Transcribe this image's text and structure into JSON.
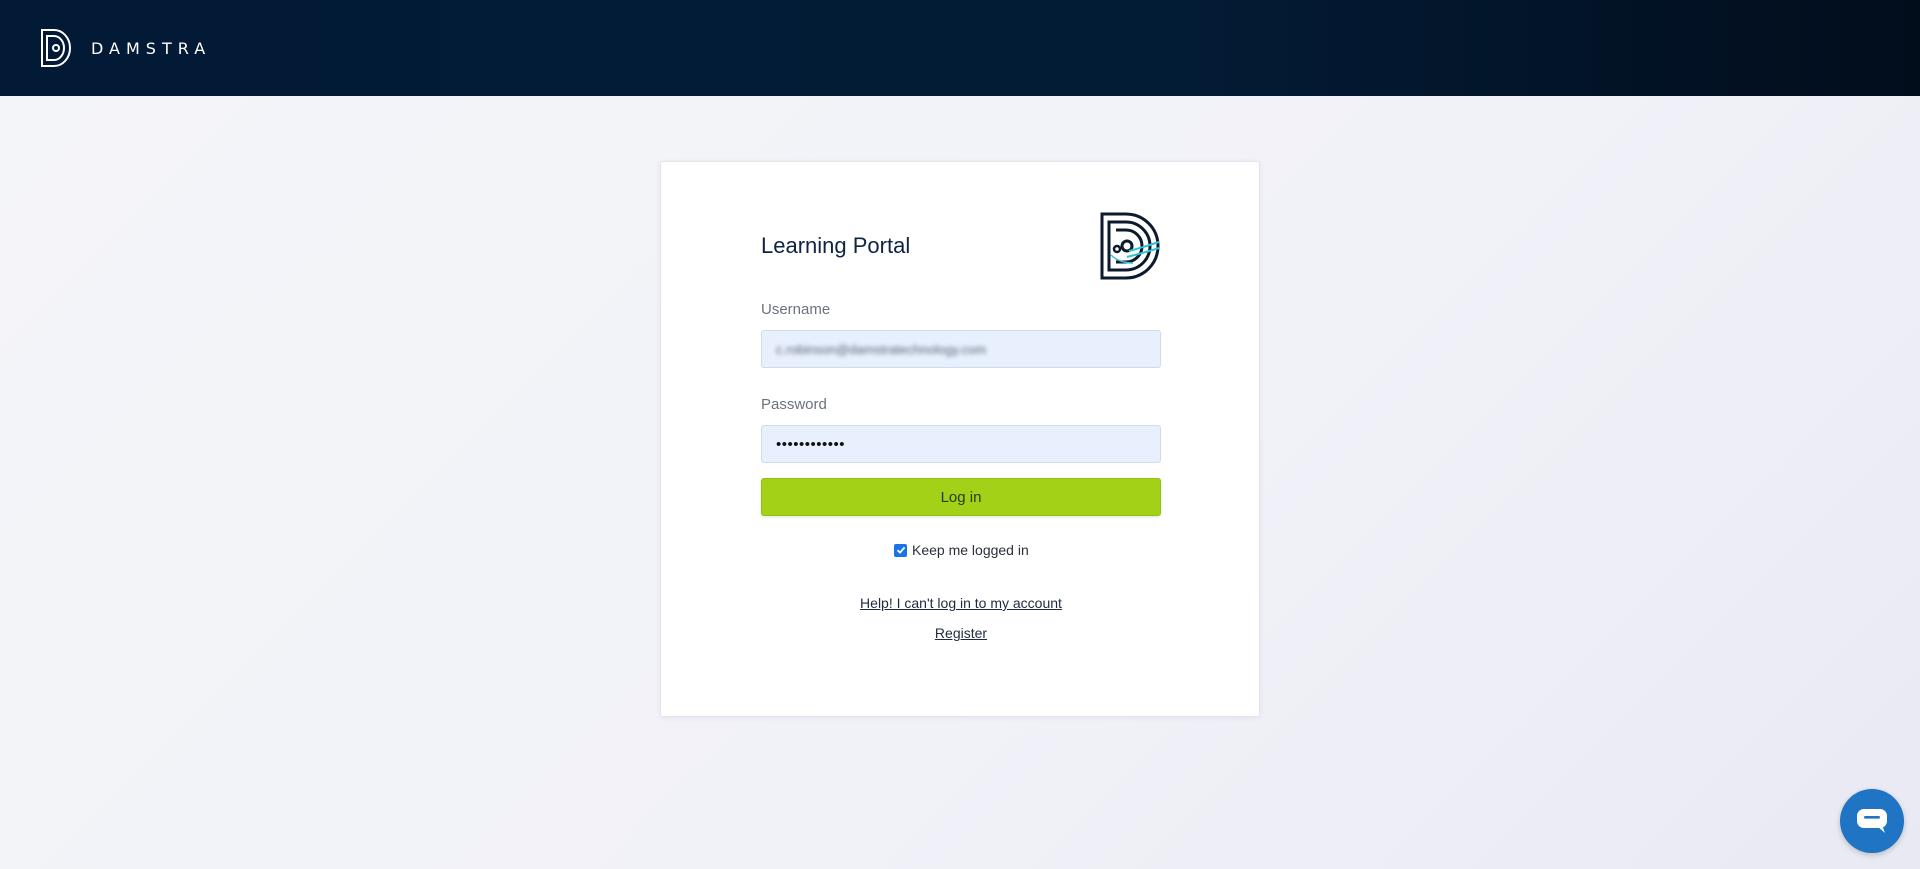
{
  "header": {
    "brand_name": "DAMSTRA",
    "brand_icon": "damstra-logo-icon"
  },
  "login": {
    "title": "Learning Portal",
    "logo_icon": "damstra-logo-icon",
    "username_label": "Username",
    "username_value": "c.robinson@damstratechnology.com",
    "password_label": "Password",
    "password_value": "••••••••••••",
    "login_button": "Log in",
    "keep_logged_in_label": "Keep me logged in",
    "keep_logged_in_checked": true,
    "help_link": "Help! I can't log in to my account",
    "register_link": "Register"
  },
  "chat": {
    "icon": "chat-bubble-icon"
  },
  "colors": {
    "header_bg": "#021a35",
    "login_button_bg": "#a2d118",
    "input_bg": "#e8f0fe",
    "chat_button_bg": "#1f74c3"
  }
}
